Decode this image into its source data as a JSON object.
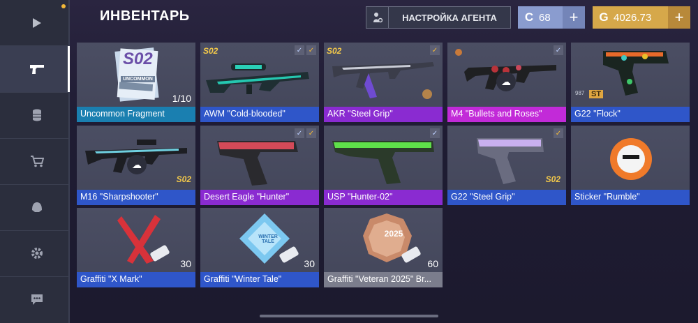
{
  "header": {
    "title": "ИНВЕНТАРЬ",
    "agent_button": "НАСТРОЙКА АГЕНТА",
    "currency_credits": "68",
    "currency_gold": "4026.73",
    "currency_credits_icon": "C",
    "currency_gold_icon": "G",
    "plus": "+"
  },
  "sidebar": {
    "items": [
      {
        "icon": "play-icon"
      },
      {
        "icon": "pistol-icon",
        "active": true
      },
      {
        "icon": "coins-icon"
      },
      {
        "icon": "cart-icon"
      },
      {
        "icon": "helmet-icon"
      },
      {
        "icon": "gear-icon"
      },
      {
        "icon": "chat-icon"
      }
    ]
  },
  "items": [
    {
      "name": "Uncommon Fragment",
      "rarity": "cyan",
      "count": "1/10",
      "card_big": "S02",
      "card_small": "UNCOMMON"
    },
    {
      "name": "AWM \"Cold-blooded\"",
      "rarity": "blue",
      "badge": "S02"
    },
    {
      "name": "AKR \"Steel Grip\"",
      "rarity": "purple",
      "badge": "S02"
    },
    {
      "name": "M4 \"Bullets and Roses\"",
      "rarity": "pink"
    },
    {
      "name": "G22 \"Flock\"",
      "rarity": "blue",
      "badge_st": "ST",
      "small_num": "987"
    },
    {
      "name": "M16 \"Sharpshooter\"",
      "rarity": "blue",
      "badge": "S02"
    },
    {
      "name": "Desert Eagle \"Hunter\"",
      "rarity": "purple"
    },
    {
      "name": "USP \"Hunter-02\"",
      "rarity": "purple"
    },
    {
      "name": "G22 \"Steel Grip\"",
      "rarity": "blue",
      "badge": "S02"
    },
    {
      "name": "Sticker \"Rumble\"",
      "rarity": "blue"
    },
    {
      "name": "Graffiti \"X Mark\"",
      "rarity": "blue",
      "count": "30"
    },
    {
      "name": "Graffiti \"Winter Tale\"",
      "rarity": "blue",
      "count": "30",
      "art_text": "WINTER TALE"
    },
    {
      "name": "Graffiti \"Veteran 2025\" Br...",
      "rarity": "gray",
      "count": "60",
      "art_text": "2025"
    }
  ],
  "colors": {
    "cyan": "#1a7fb0",
    "blue": "#2f56c9",
    "purple": "#8a2bd1",
    "pink": "#c22ad8",
    "gray": "#7b7d8c",
    "gold": "#d6a84a",
    "credits": "#8a9ccf"
  }
}
